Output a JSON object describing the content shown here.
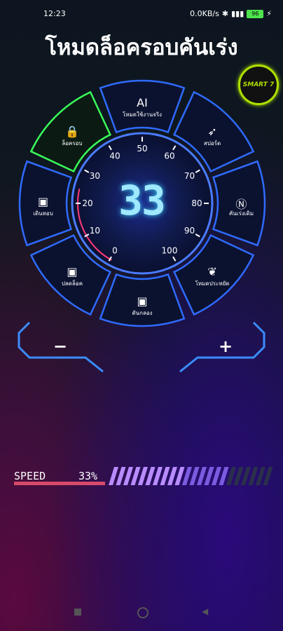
{
  "status": {
    "time": "12:23",
    "net": "0.0KB/s",
    "battery": "96"
  },
  "title": "โหมดล็อครอบคันเร่ง",
  "badge": {
    "text": "SMART 7"
  },
  "segments": [
    {
      "id": "ai",
      "label": "โหมดใช้งานจริง",
      "icon_text": "AI"
    },
    {
      "id": "sport",
      "label": "สปอร์ต",
      "icon": "rocket-icon"
    },
    {
      "id": "normal",
      "label": "คันเร่งเดิม",
      "icon": "n-icon"
    },
    {
      "id": "eco",
      "label": "โหมดประหยัด",
      "icon": "leaf-icon"
    },
    {
      "id": "hold",
      "label": "ดันกลอง",
      "icon": "hand-lock-icon"
    },
    {
      "id": "tow",
      "label": "ปลดล็อค",
      "icon": "tow-truck-icon"
    },
    {
      "id": "walk",
      "label": "เดินหอบ",
      "icon": "car-up-icon"
    },
    {
      "id": "lock",
      "label": "ล็อครอบ",
      "icon": "lock-icon"
    }
  ],
  "gauge": {
    "ticks": [
      "0",
      "10",
      "20",
      "30",
      "40",
      "50",
      "60",
      "70",
      "80",
      "90",
      "100"
    ],
    "value": "33"
  },
  "controls": {
    "minus": "−",
    "plus": "+"
  },
  "speed": {
    "label": "SPEED",
    "percent": "33%",
    "fraction": 0.33
  },
  "colors": {
    "accent": "#2f6bff",
    "active": "#39ff5a",
    "digits": "#9fe8ff"
  }
}
